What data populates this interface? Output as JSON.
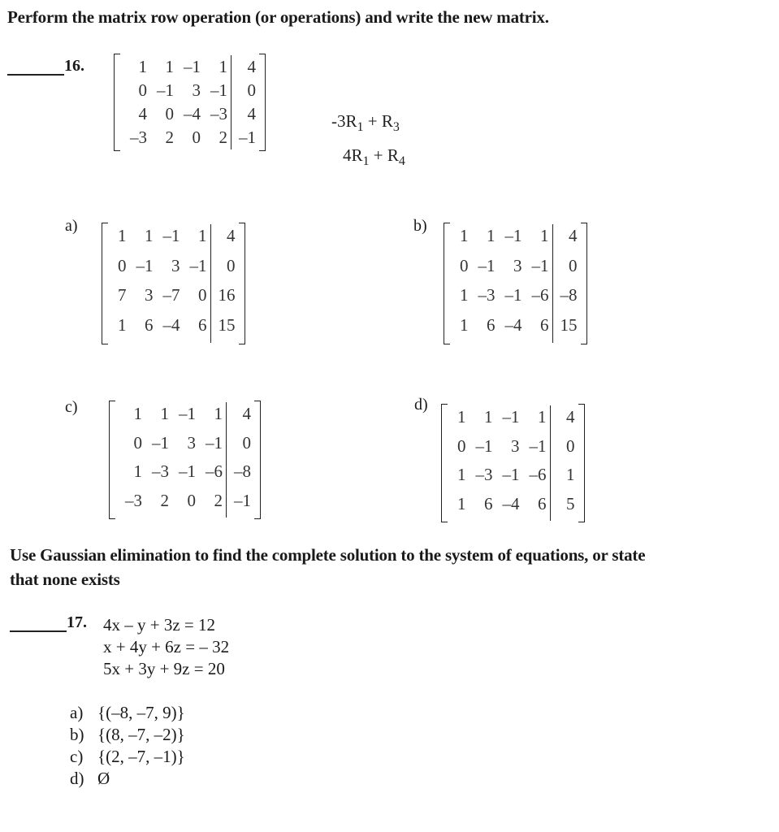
{
  "section1": {
    "instruction": "Perform the matrix row operation (or operations) and write the new matrix."
  },
  "q16": {
    "number": "16.",
    "matrix": {
      "coef": [
        [
          "1",
          "1",
          "-1",
          "1"
        ],
        [
          "0",
          "-1",
          "3",
          "-1"
        ],
        [
          "4",
          "0",
          "-4",
          "-3"
        ],
        [
          "-3",
          "2",
          "0",
          "2"
        ]
      ],
      "rhs": [
        "4",
        "0",
        "4",
        "-1"
      ]
    },
    "row_operations": [
      {
        "text": "-3R",
        "sub1": "1",
        "plus": " + R",
        "sub2": "3"
      },
      {
        "text": "4R",
        "sub1": "1",
        "plus": " + R",
        "sub2": "4"
      }
    ],
    "options": {
      "a": {
        "label": "a)",
        "coef": [
          [
            "1",
            "1",
            "-1",
            "1"
          ],
          [
            "0",
            "-1",
            "3",
            "-1"
          ],
          [
            "7",
            "3",
            "-7",
            "0"
          ],
          [
            "1",
            "6",
            "-4",
            "6"
          ]
        ],
        "rhs": [
          "4",
          "0",
          "16",
          "15"
        ]
      },
      "b": {
        "label": "b)",
        "coef": [
          [
            "1",
            "1",
            "-1",
            "1"
          ],
          [
            "0",
            "-1",
            "3",
            "-1"
          ],
          [
            "1",
            "-3",
            "-1",
            "-6"
          ],
          [
            "1",
            "6",
            "-4",
            "6"
          ]
        ],
        "rhs": [
          "4",
          "0",
          "-8",
          "15"
        ]
      },
      "c": {
        "label": "c)",
        "coef": [
          [
            "1",
            "1",
            "-1",
            "1"
          ],
          [
            "0",
            "-1",
            "3",
            "-1"
          ],
          [
            "1",
            "-3",
            "-1",
            "-6"
          ],
          [
            "-3",
            "2",
            "0",
            "2"
          ]
        ],
        "rhs": [
          "4",
          "0",
          "-8",
          "-1"
        ]
      },
      "d": {
        "label": "d)",
        "coef": [
          [
            "1",
            "1",
            "-1",
            "1"
          ],
          [
            "0",
            "-1",
            "3",
            "-1"
          ],
          [
            "1",
            "-3",
            "-1",
            "-6"
          ],
          [
            "1",
            "6",
            "-4",
            "6"
          ]
        ],
        "rhs": [
          "4",
          "0",
          "1",
          "5"
        ]
      }
    }
  },
  "section2": {
    "instruction_line1": "Use Gaussian elimination to find the complete solution to the system of equations, or state",
    "instruction_line2": "that none exists"
  },
  "q17": {
    "number": "17.",
    "equations": [
      "4x – y + 3z = 12",
      "x + 4y + 6z = – 32",
      "5x + 3y + 9z = 20"
    ],
    "choices": [
      {
        "label": "a)",
        "text": "{(–8, –7, 9)}"
      },
      {
        "label": "b)",
        "text": "{(8, –7, –2)}"
      },
      {
        "label": "c)",
        "text": "{(2, –7, –1)}"
      },
      {
        "label": "d)",
        "text": "Ø"
      }
    ]
  }
}
